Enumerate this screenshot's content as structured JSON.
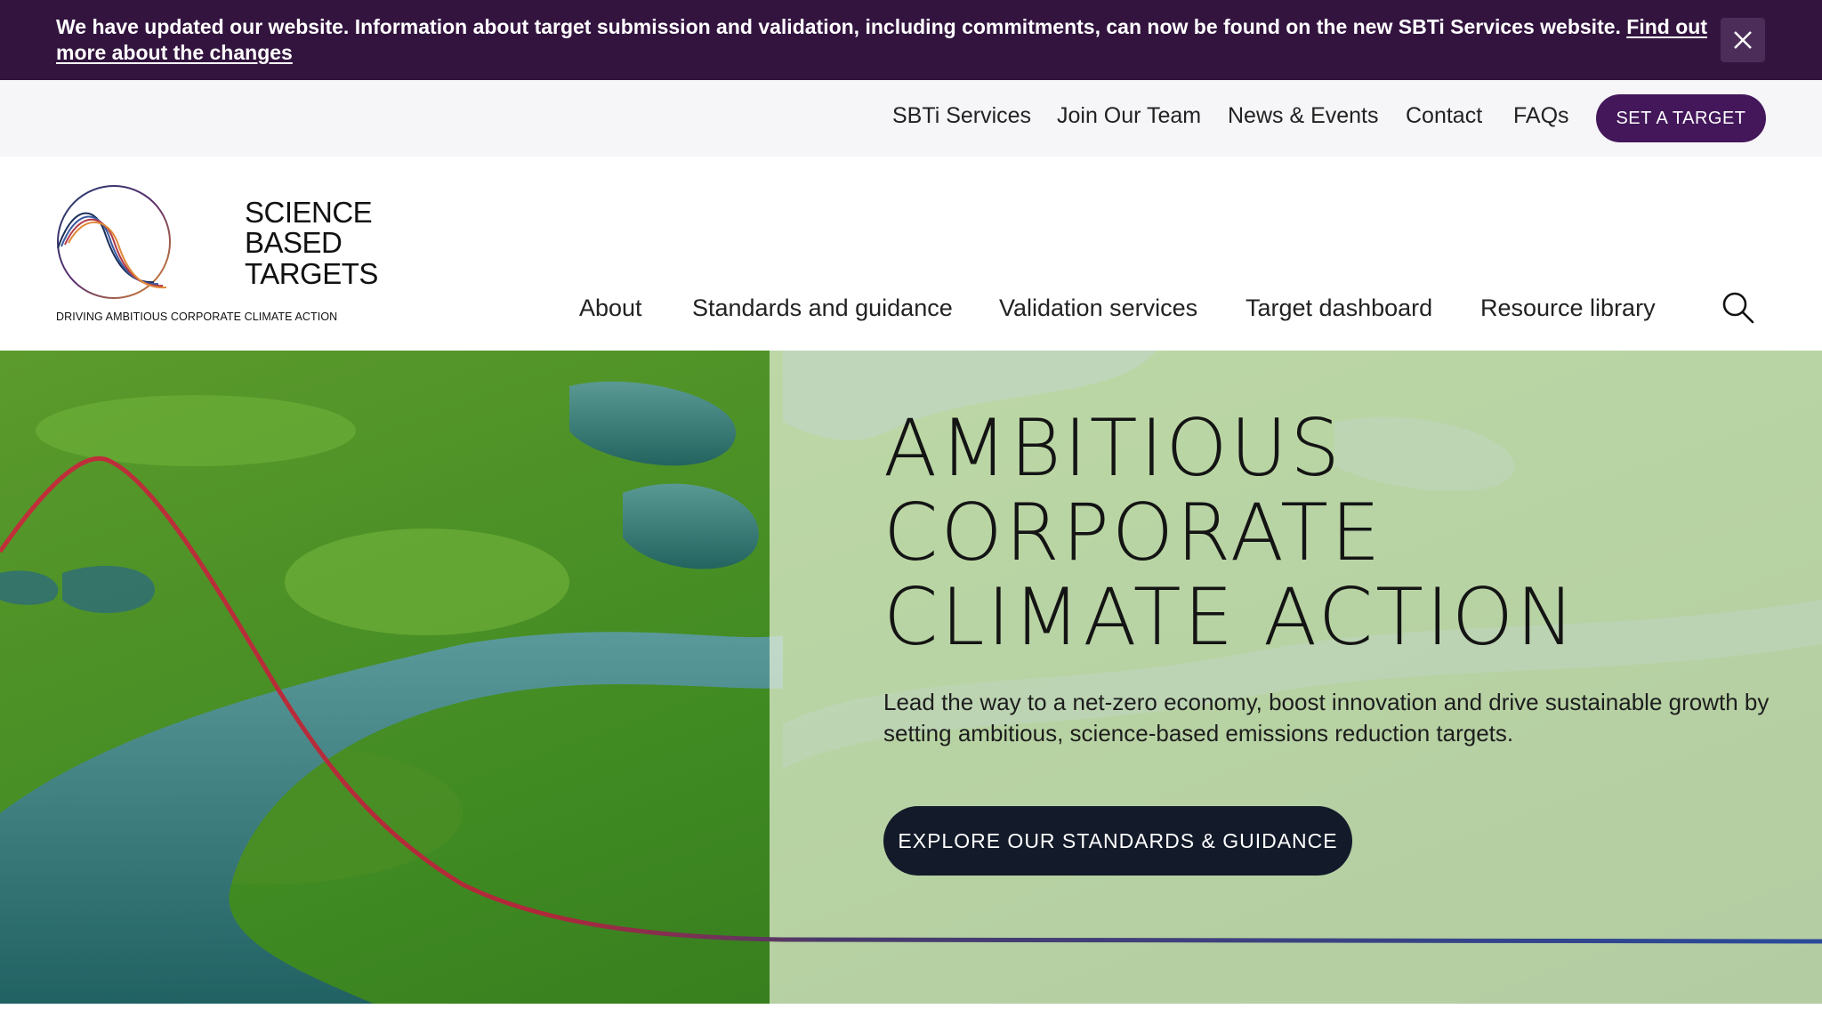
{
  "banner": {
    "text": "We have updated our website. Information about target submission and validation, including commitments, can now be found on the new SBTi Services website. ",
    "link_text": "Find out more about the changes",
    "close_icon": "close-icon"
  },
  "utility_nav": {
    "items": [
      {
        "label": "SBTi Services"
      },
      {
        "label": "Join Our Team"
      },
      {
        "label": "News & Events"
      },
      {
        "label": "Contact"
      },
      {
        "label": "FAQs"
      }
    ],
    "cta_label": "SET A TARGET"
  },
  "logo": {
    "line1": "SCIENCE",
    "line2": "BASED",
    "line3": "TARGETS",
    "tagline": "DRIVING AMBITIOUS CORPORATE CLIMATE ACTION"
  },
  "main_nav": {
    "items": [
      {
        "label": "About"
      },
      {
        "label": "Standards and guidance"
      },
      {
        "label": "Validation services"
      },
      {
        "label": "Target dashboard"
      },
      {
        "label": "Resource library"
      }
    ],
    "search_icon": "search-icon"
  },
  "hero": {
    "title_lines": [
      "AMBITIOUS",
      "CORPORATE",
      "CLIMATE ACTION"
    ],
    "subtitle": "Lead the way to a net-zero economy, boost innovation and drive sustainable growth by setting ambitious, science-based emissions reduction targets.",
    "cta_label": "EXPLORE OUR STANDARDS & GUIDANCE"
  },
  "colors": {
    "banner_bg": "#33143f",
    "brand_purple": "#43175a",
    "dark_navy": "#131a2a",
    "curve_red": "#c0303a",
    "curve_blue": "#2a4a9a"
  }
}
